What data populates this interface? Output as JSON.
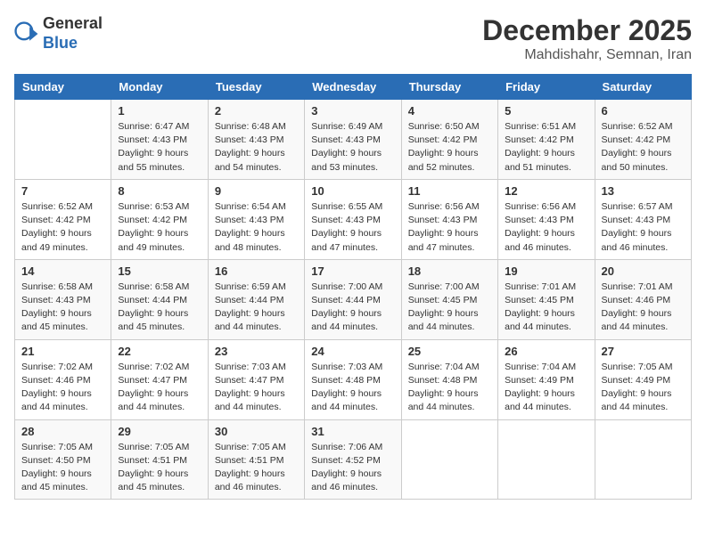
{
  "logo": {
    "general": "General",
    "blue": "Blue"
  },
  "title": "December 2025",
  "location": "Mahdishahr, Semnan, Iran",
  "days_of_week": [
    "Sunday",
    "Monday",
    "Tuesday",
    "Wednesday",
    "Thursday",
    "Friday",
    "Saturday"
  ],
  "weeks": [
    [
      {
        "day": null
      },
      {
        "day": 1,
        "sunrise": "6:47 AM",
        "sunset": "4:43 PM",
        "daylight": "9 hours and 55 minutes."
      },
      {
        "day": 2,
        "sunrise": "6:48 AM",
        "sunset": "4:43 PM",
        "daylight": "9 hours and 54 minutes."
      },
      {
        "day": 3,
        "sunrise": "6:49 AM",
        "sunset": "4:43 PM",
        "daylight": "9 hours and 53 minutes."
      },
      {
        "day": 4,
        "sunrise": "6:50 AM",
        "sunset": "4:42 PM",
        "daylight": "9 hours and 52 minutes."
      },
      {
        "day": 5,
        "sunrise": "6:51 AM",
        "sunset": "4:42 PM",
        "daylight": "9 hours and 51 minutes."
      },
      {
        "day": 6,
        "sunrise": "6:52 AM",
        "sunset": "4:42 PM",
        "daylight": "9 hours and 50 minutes."
      }
    ],
    [
      {
        "day": 7,
        "sunrise": "6:52 AM",
        "sunset": "4:42 PM",
        "daylight": "9 hours and 49 minutes."
      },
      {
        "day": 8,
        "sunrise": "6:53 AM",
        "sunset": "4:42 PM",
        "daylight": "9 hours and 49 minutes."
      },
      {
        "day": 9,
        "sunrise": "6:54 AM",
        "sunset": "4:43 PM",
        "daylight": "9 hours and 48 minutes."
      },
      {
        "day": 10,
        "sunrise": "6:55 AM",
        "sunset": "4:43 PM",
        "daylight": "9 hours and 47 minutes."
      },
      {
        "day": 11,
        "sunrise": "6:56 AM",
        "sunset": "4:43 PM",
        "daylight": "9 hours and 47 minutes."
      },
      {
        "day": 12,
        "sunrise": "6:56 AM",
        "sunset": "4:43 PM",
        "daylight": "9 hours and 46 minutes."
      },
      {
        "day": 13,
        "sunrise": "6:57 AM",
        "sunset": "4:43 PM",
        "daylight": "9 hours and 46 minutes."
      }
    ],
    [
      {
        "day": 14,
        "sunrise": "6:58 AM",
        "sunset": "4:43 PM",
        "daylight": "9 hours and 45 minutes."
      },
      {
        "day": 15,
        "sunrise": "6:58 AM",
        "sunset": "4:44 PM",
        "daylight": "9 hours and 45 minutes."
      },
      {
        "day": 16,
        "sunrise": "6:59 AM",
        "sunset": "4:44 PM",
        "daylight": "9 hours and 44 minutes."
      },
      {
        "day": 17,
        "sunrise": "7:00 AM",
        "sunset": "4:44 PM",
        "daylight": "9 hours and 44 minutes."
      },
      {
        "day": 18,
        "sunrise": "7:00 AM",
        "sunset": "4:45 PM",
        "daylight": "9 hours and 44 minutes."
      },
      {
        "day": 19,
        "sunrise": "7:01 AM",
        "sunset": "4:45 PM",
        "daylight": "9 hours and 44 minutes."
      },
      {
        "day": 20,
        "sunrise": "7:01 AM",
        "sunset": "4:46 PM",
        "daylight": "9 hours and 44 minutes."
      }
    ],
    [
      {
        "day": 21,
        "sunrise": "7:02 AM",
        "sunset": "4:46 PM",
        "daylight": "9 hours and 44 minutes."
      },
      {
        "day": 22,
        "sunrise": "7:02 AM",
        "sunset": "4:47 PM",
        "daylight": "9 hours and 44 minutes."
      },
      {
        "day": 23,
        "sunrise": "7:03 AM",
        "sunset": "4:47 PM",
        "daylight": "9 hours and 44 minutes."
      },
      {
        "day": 24,
        "sunrise": "7:03 AM",
        "sunset": "4:48 PM",
        "daylight": "9 hours and 44 minutes."
      },
      {
        "day": 25,
        "sunrise": "7:04 AM",
        "sunset": "4:48 PM",
        "daylight": "9 hours and 44 minutes."
      },
      {
        "day": 26,
        "sunrise": "7:04 AM",
        "sunset": "4:49 PM",
        "daylight": "9 hours and 44 minutes."
      },
      {
        "day": 27,
        "sunrise": "7:05 AM",
        "sunset": "4:49 PM",
        "daylight": "9 hours and 44 minutes."
      }
    ],
    [
      {
        "day": 28,
        "sunrise": "7:05 AM",
        "sunset": "4:50 PM",
        "daylight": "9 hours and 45 minutes."
      },
      {
        "day": 29,
        "sunrise": "7:05 AM",
        "sunset": "4:51 PM",
        "daylight": "9 hours and 45 minutes."
      },
      {
        "day": 30,
        "sunrise": "7:05 AM",
        "sunset": "4:51 PM",
        "daylight": "9 hours and 46 minutes."
      },
      {
        "day": 31,
        "sunrise": "7:06 AM",
        "sunset": "4:52 PM",
        "daylight": "9 hours and 46 minutes."
      },
      {
        "day": null
      },
      {
        "day": null
      },
      {
        "day": null
      }
    ]
  ]
}
